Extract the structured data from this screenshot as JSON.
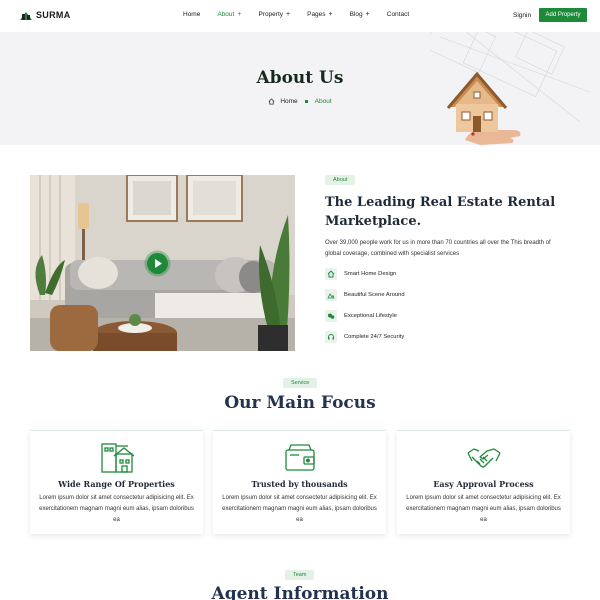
{
  "header": {
    "logo": "SURMA",
    "nav": [
      {
        "label": "Home",
        "plus": false,
        "active": false
      },
      {
        "label": "About",
        "plus": true,
        "active": true
      },
      {
        "label": "Property",
        "plus": true,
        "active": false
      },
      {
        "label": "Pages",
        "plus": true,
        "active": false
      },
      {
        "label": "Blog",
        "plus": true,
        "active": false
      },
      {
        "label": "Contact",
        "plus": false,
        "active": false
      }
    ],
    "signin": "Signin",
    "add_property": "Add Property"
  },
  "hero": {
    "title": "About Us",
    "breadcrumb": {
      "home": "Home",
      "current": "About"
    }
  },
  "about": {
    "tag": "About",
    "title": "The Leading Real Estate Rental Marketplace.",
    "description": "Over 39,000 people work for us in more than 70 countries all over the This breadth of global coverage, combined with specialist services",
    "features": [
      {
        "label": "Smart Home Design",
        "icon": "home-icon"
      },
      {
        "label": "Beautiful Scene Around",
        "icon": "landscape-icon"
      },
      {
        "label": "Exceptional Lifestyle",
        "icon": "lifestyle-icon"
      },
      {
        "label": "Complete 24/7 Security",
        "icon": "headset-icon"
      }
    ]
  },
  "service": {
    "tag": "Service",
    "title": "Our Main Focus",
    "cards": [
      {
        "title": "Wide Range Of Properties",
        "icon": "buildings-icon",
        "desc": "Lorem ipsum dolor sit amet consectetur adipisicing elit. Ex exercitationem magnam magni eum alias, ipsam doloribus ea"
      },
      {
        "title": "Trusted by thousands",
        "icon": "wallet-icon",
        "desc": "Lorem ipsum dolor sit amet consectetur adipisicing elit. Ex exercitationem magnam magni eum alias, ipsam doloribus ea"
      },
      {
        "title": "Easy Approval Process",
        "icon": "handshake-icon",
        "desc": "Lorem ipsum dolor sit amet consectetur adipisicing elit. Ex exercitationem magnam magni eum alias, ipsam doloribus ea"
      }
    ]
  },
  "team": {
    "tag": "Team",
    "title": "Agent Information"
  },
  "colors": {
    "accent": "#1d8a3a",
    "heading": "#23334f",
    "hero_bg": "#f3f3f5"
  }
}
